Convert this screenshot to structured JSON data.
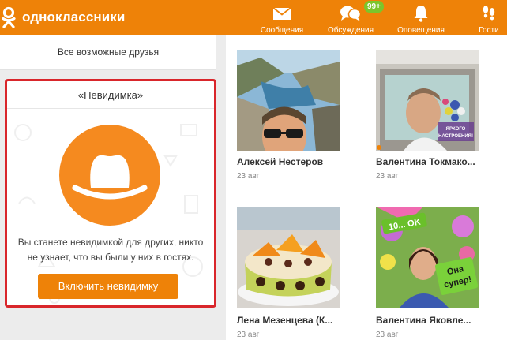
{
  "header": {
    "logo_text": "одноклассники",
    "nav": [
      {
        "label": "Сообщения",
        "icon": "envelope-icon"
      },
      {
        "label": "Обсуждения",
        "icon": "chat-bubbles-icon"
      },
      {
        "label": "Оповещения",
        "icon": "bell-icon"
      },
      {
        "label": "Гости",
        "icon": "footprints-icon"
      }
    ],
    "discussions_badge": "99+",
    "colors": {
      "brand": "#ee8208",
      "badge": "#7cc52b"
    }
  },
  "sidebar": {
    "friends_link": "Все возможные друзья",
    "invisible": {
      "title": "«Невидимка»",
      "icon": "hat-icon",
      "description": "Вы станете невидимкой для других, никто не узнает, что вы были у них в гостях.",
      "button_label": "Включить невидимку",
      "highlight_color": "#d9262b"
    }
  },
  "feed": {
    "items": [
      {
        "name": "Алексей Нестеров",
        "date": "23 авг",
        "photo": "man-at-cliffs-photo"
      },
      {
        "name": "Валентина Токмако...",
        "date": "23 авг",
        "photo": "man-in-car-photo",
        "overlay_text": "ЯРКОГО НАСТРОЕНИЯ!"
      },
      {
        "name": "Лена Мезенцева (К...",
        "date": "23 авг",
        "photo": "fruit-cake-photo"
      },
      {
        "name": "Валентина Яковле...",
        "date": "23 авг",
        "photo": "woman-with-flowers-photo",
        "overlay_top": "10... OK",
        "overlay_sticker": "Она супер!"
      }
    ]
  }
}
